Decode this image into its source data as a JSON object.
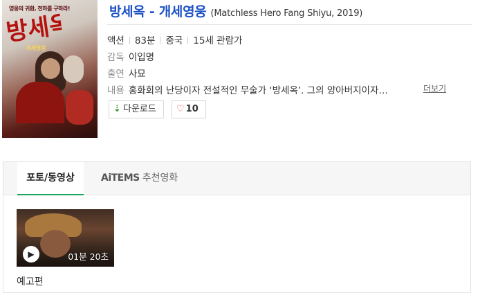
{
  "movie": {
    "poster": {
      "tagline": "영웅의 귀환, 천하를 구하라!",
      "title_art": "방세옥",
      "subtitle_art": "개세영웅"
    },
    "title": "방세옥 - 개세영웅",
    "title_en": "(Matchless Hero Fang Shiyu, 2019)",
    "meta": {
      "genre": "액션",
      "runtime": "83분",
      "country": "중국",
      "rating": "15세 관람가"
    },
    "director_label": "감독",
    "director": "이입명",
    "cast_label": "출연",
    "cast": "사묘",
    "description_label": "내용",
    "description": "홍화회의 난당이자 전설적인 무술가 ‘방세옥’. 그의 양아버지이자…",
    "more_label": "더보기",
    "download_label": "다운로드",
    "like_count": "10"
  },
  "tabs": [
    {
      "label": "포토/동영상",
      "active": true
    },
    {
      "brand": "AiTEMS",
      "label": "추천영화",
      "active": false
    }
  ],
  "media": {
    "duration": "01분 20초",
    "caption": "예고편"
  },
  "colors": {
    "title": "#1d52c4",
    "tab_underline": "#1aa35a",
    "heart": "#e2424b",
    "download_arrow": "#2e9b2e"
  },
  "icons": [
    "download-icon",
    "heart-icon",
    "play-icon"
  ]
}
